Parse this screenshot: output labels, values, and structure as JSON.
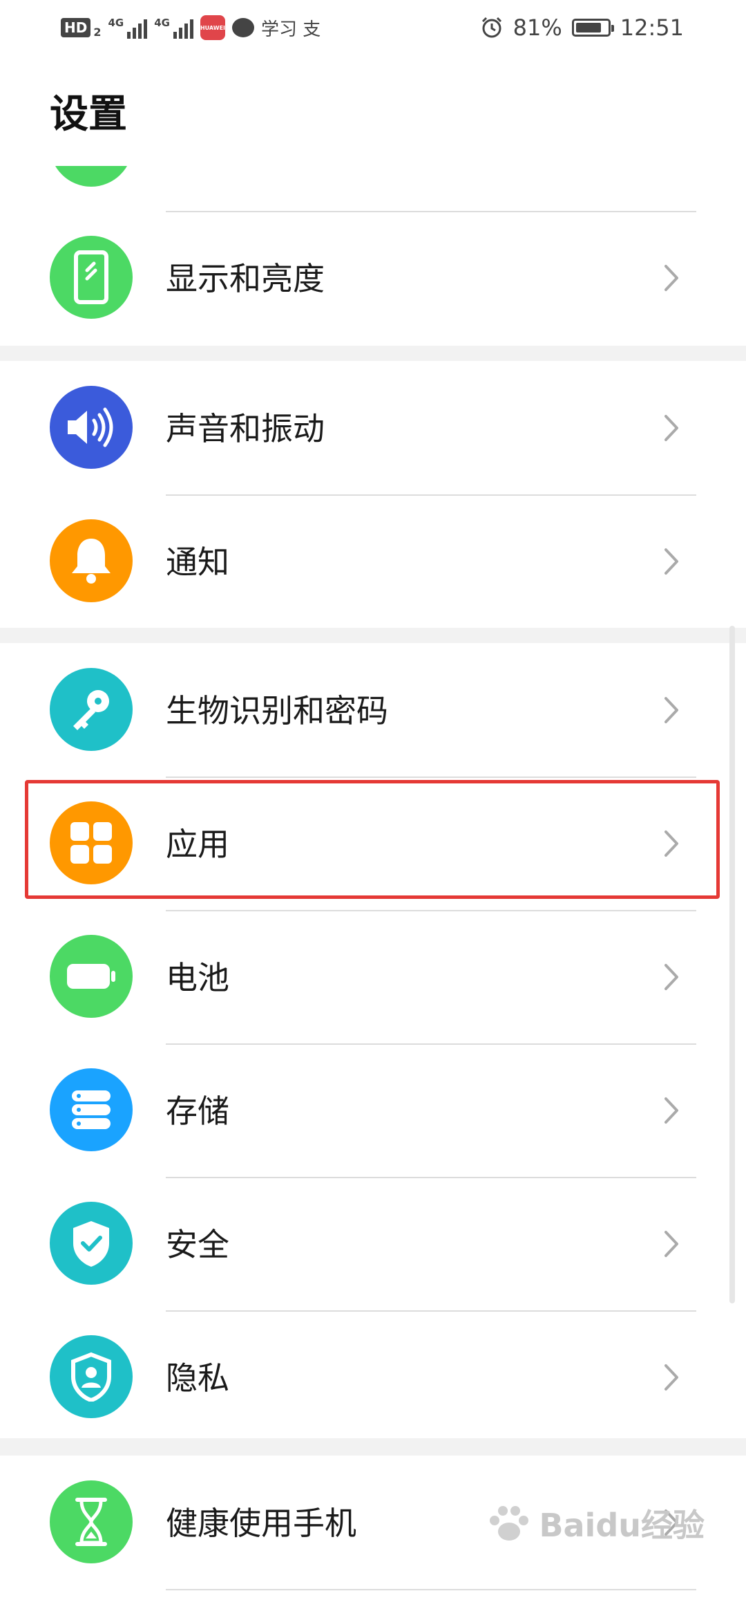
{
  "status_bar": {
    "hd_label": "HD",
    "hd_sub": "2",
    "signal1_label": "4G",
    "signal2_label": "4G",
    "app_badge": "HUAWEI",
    "misc_text": "学习 支",
    "battery_percent": "81%",
    "battery_level": 0.81,
    "time": "12:51"
  },
  "page": {
    "title": "设置"
  },
  "groups": [
    {
      "items": [
        {
          "label": "显示和亮度",
          "icon": "display-phone-icon",
          "color": "#4cd964"
        }
      ]
    },
    {
      "items": [
        {
          "label": "声音和振动",
          "icon": "speaker-icon",
          "color": "#3b5bdb"
        },
        {
          "label": "通知",
          "icon": "bell-icon",
          "color": "#ff9800"
        }
      ]
    },
    {
      "items": [
        {
          "label": "生物识别和密码",
          "icon": "key-icon",
          "color": "#1fc0c8"
        },
        {
          "label": "应用",
          "icon": "apps-grid-icon",
          "color": "#ff9800"
        },
        {
          "label": "电池",
          "icon": "battery-icon",
          "color": "#4cd964"
        },
        {
          "label": "存储",
          "icon": "storage-icon",
          "color": "#1aa3ff"
        },
        {
          "label": "安全",
          "icon": "shield-check-icon",
          "color": "#1fc0c8"
        },
        {
          "label": "隐私",
          "icon": "privacy-shield-icon",
          "color": "#1fc0c8"
        }
      ]
    },
    {
      "items": [
        {
          "label": "健康使用手机",
          "icon": "hourglass-icon",
          "color": "#4cd964"
        }
      ]
    }
  ],
  "watermark": {
    "text": "Baidu经验"
  }
}
